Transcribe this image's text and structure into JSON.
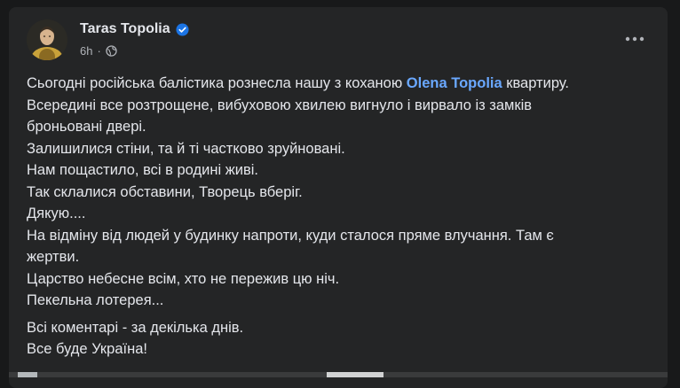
{
  "post": {
    "author": "Taras Topolia",
    "timestamp": "6h",
    "privacy_icon": "globe-icon",
    "verified_icon": "verified-badge-icon",
    "more_icon": "more-horizontal-icon",
    "line1_before": "Сьогодні російська балістика рознесла нашу з коханою ",
    "mention": "Olena Topolia",
    "line1_after": " квартиру.",
    "lines": [
      "Всередині все розтрощене, вибуховою хвилею вигнуло і вирвало із замків",
      "броньовані двері.",
      "Залишилися стіни, та й ті частково зруйновані.",
      "Нам пощастило, всі в родині живі.",
      "Так склалися обставини, Творець вберіг.",
      "Дякую....",
      "На відміну від людей у будинку напроти, куди сталося пряме влучання. Там є",
      "жертви.",
      "Царство небесне всім, хто не пережив цю ніч.",
      "Пекельна лотерея..."
    ],
    "closing": [
      "Всі коментарі - за декілька днів.",
      "Все буде Україна!"
    ]
  },
  "colors": {
    "background": "#18191a",
    "card": "#242526",
    "text": "#e4e6eb",
    "secondary_text": "#b0b3b8",
    "mention": "#6aa8ff",
    "verified": "#1b74e4"
  }
}
